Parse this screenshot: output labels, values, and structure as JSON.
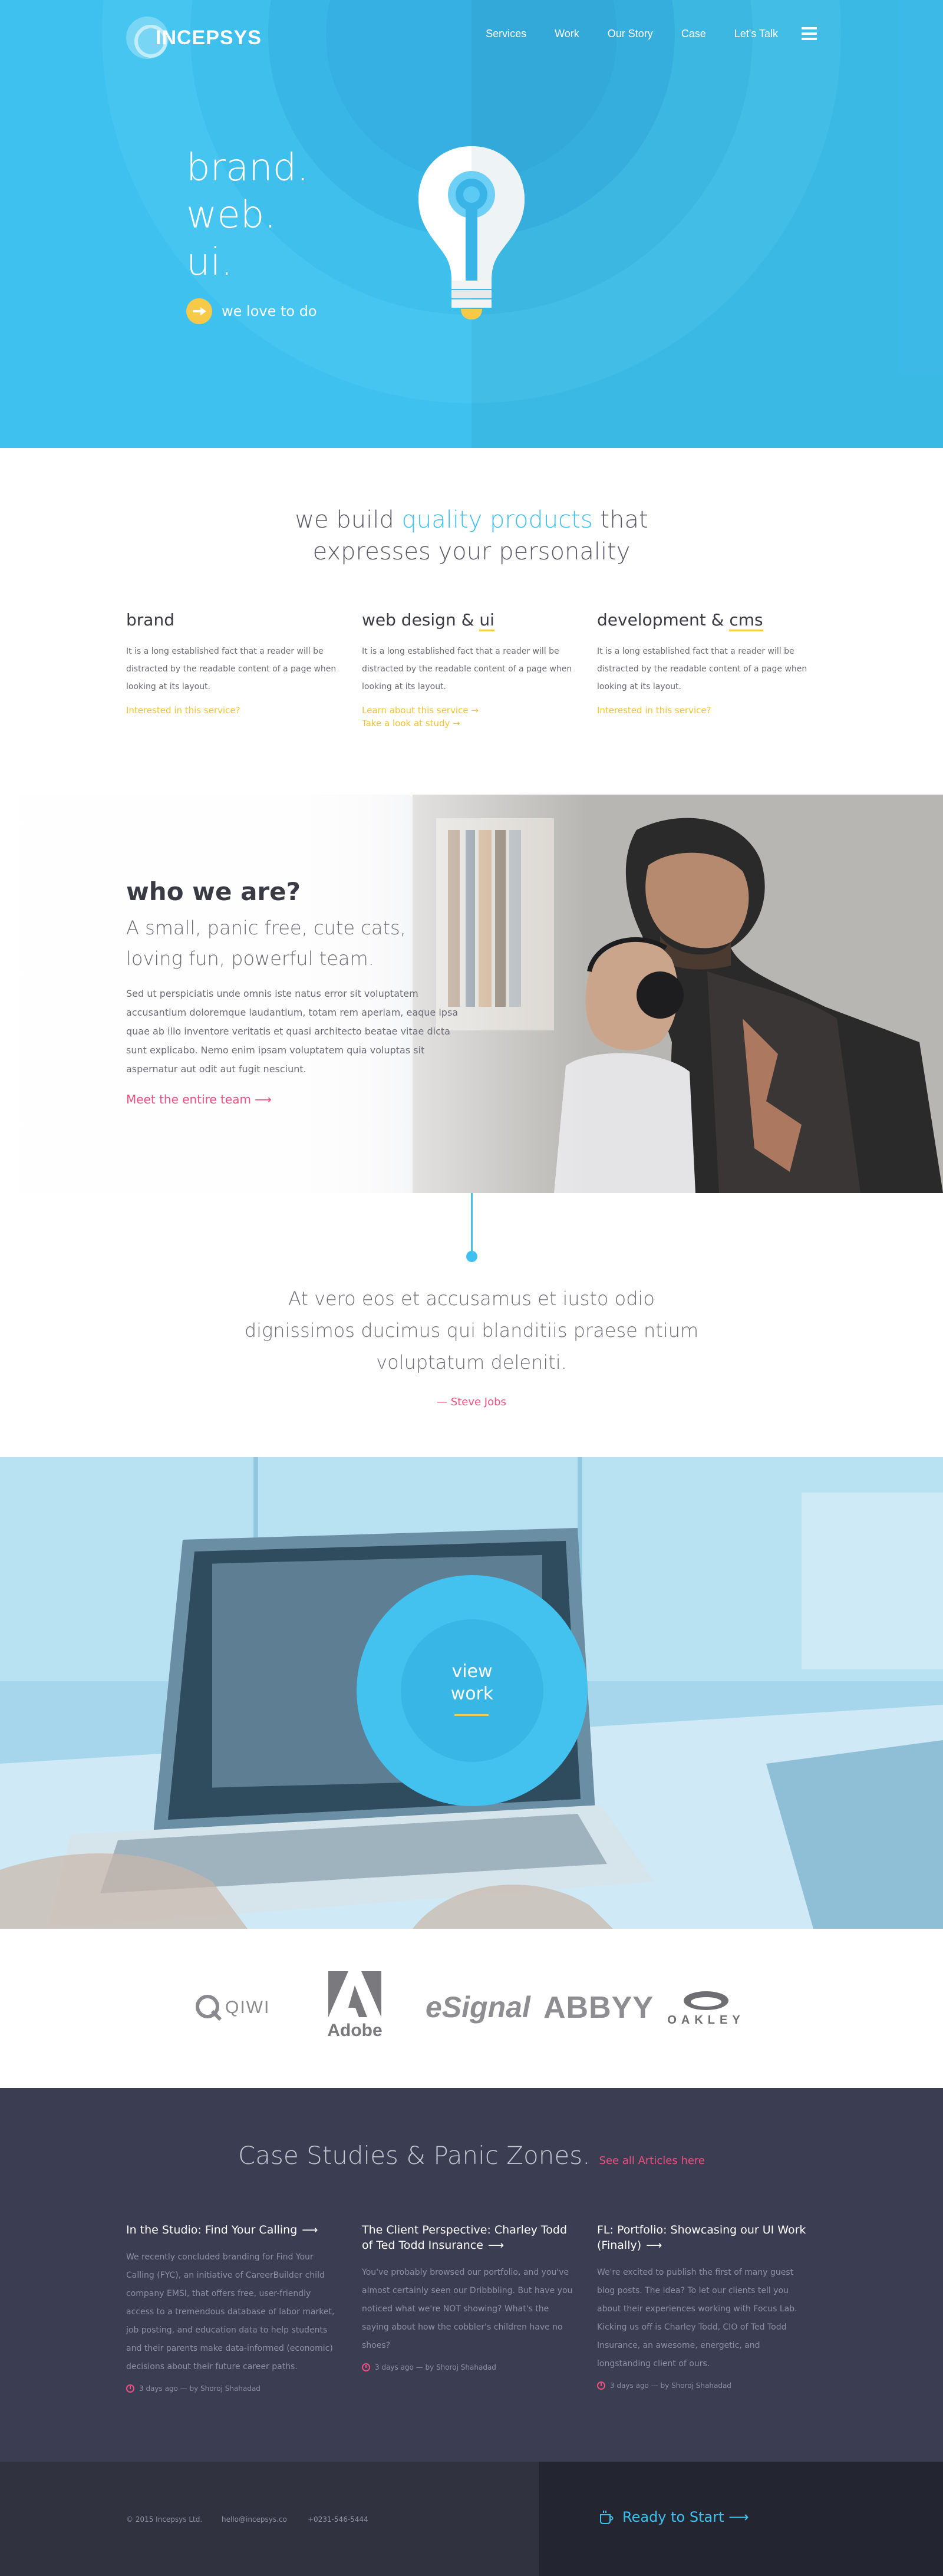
{
  "brand": {
    "name": "INCEPSYS"
  },
  "nav": {
    "items": [
      "Services",
      "Work",
      "Our Story",
      "Case",
      "Let's Talk"
    ]
  },
  "hero": {
    "lines": [
      "brand.",
      "web.",
      "ui."
    ],
    "cta": "we love to do"
  },
  "intro": {
    "pre": "we build ",
    "highlight": "quality products",
    "post": " that",
    "line2": "expresses your personality"
  },
  "services": [
    {
      "title_a": "brand",
      "title_b": "",
      "body": "It is a long established fact that a reader will be distracted by the readable content of a page when looking at its layout.",
      "link": "Interested in this service?",
      "link2": ""
    },
    {
      "title_a": "web design & ",
      "title_b": "ui",
      "body": "It is a long established fact that a reader will be distracted by the readable content of a page when looking at its layout.",
      "link": "Learn about this service →",
      "link2": "Take a look at study →"
    },
    {
      "title_a": "development & ",
      "title_b": "cms",
      "body": "It is a long established fact that a reader will be distracted by the readable content of a page when looking at its layout.",
      "link": "Interested in this service?",
      "link2": ""
    }
  ],
  "who": {
    "title": "who we are?",
    "subtitle": "A small, panic free, cute cats, loving fun, powerful team.",
    "body": "Sed ut perspiciatis unde omnis iste natus error sit voluptatem accusantium doloremque laudantium, totam rem aperiam, eaque ipsa quae ab illo inventore veritatis et quasi architecto beatae vitae dicta sunt explicabo. Nemo enim ipsam voluptatem quia voluptas sit aspernatur aut odit aut fugit nesciunt.",
    "link": "Meet the entire team ⟶"
  },
  "quote": {
    "text": "At vero eos et accusamus et iusto odio dignissimos ducimus qui blanditiis praese ntium voluptatum deleniti.",
    "author": "— Steve Jobs"
  },
  "work": {
    "line1": "view",
    "line2": "work"
  },
  "clients": [
    "QIWI",
    "Adobe",
    "eSignal",
    "ABBYY",
    "OAKLEY"
  ],
  "cases": {
    "title": "Case Studies & Panic Zones.",
    "link": "See all Articles here",
    "articles": [
      {
        "title": "In the Studio: Find Your Calling",
        "body": "We recently concluded branding for Find Your Calling (FYC), an initiative of CareerBuilder child company EMSI, that offers free, user-friendly access to a tremendous database of labor market, job posting, and education data to help students and their parents make data-informed (economic) decisions about their future career paths.",
        "meta": "3 days ago — by Shoroj Shahadad"
      },
      {
        "title": "The Client Perspective: Charley Todd of Ted Todd Insurance",
        "body": "You've probably browsed our portfolio, and you've almost certainly seen our Dribbbling. But have you noticed what we're NOT showing? What's the saying about how the cobbler's children have no shoes?",
        "meta": "3 days ago — by Shoroj Shahadad"
      },
      {
        "title": "FL: Portfolio: Showcasing our UI Work (Finally)",
        "body": "We're excited to publish the first of many guest blog posts. The idea? To let our clients tell you about their experiences working with Focus Lab. Kicking us off is Charley Todd, CIO of Ted Todd Insurance, an awesome, energetic, and longstanding client of ours.",
        "meta": "3 days ago — by Shoroj Shahadad"
      }
    ]
  },
  "footer": {
    "copyright": "© 2015 Incepsys Ltd.",
    "email": "hello@incepsys.co",
    "phone": "+0231-546-5444",
    "cta": "Ready to Start ⟶"
  }
}
